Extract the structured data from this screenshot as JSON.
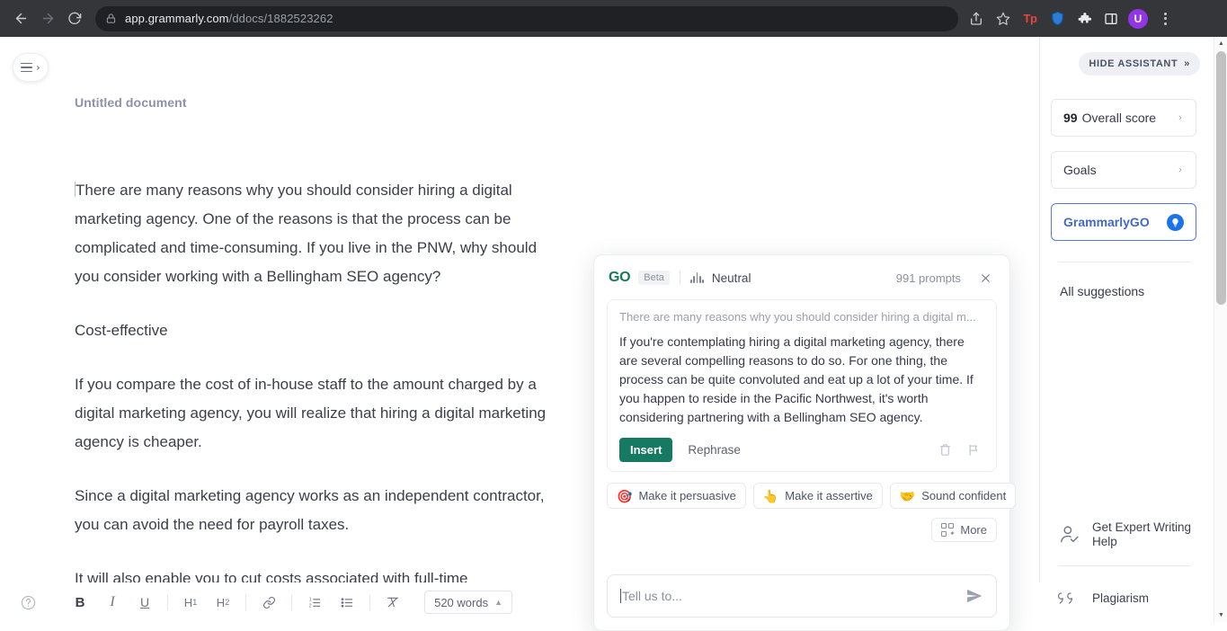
{
  "browser": {
    "back_label": "Back",
    "forward_label": "Forward",
    "reload_label": "Reload",
    "lock_icon": "lock-icon",
    "url_domain": "app.grammarly.com",
    "url_path": "/ddocs/1882523262",
    "actions": [
      {
        "name": "share-icon",
        "label": "Share"
      },
      {
        "name": "bookmark-star-icon",
        "label": "Bookmark this tab"
      },
      {
        "name": "extension-tp-icon",
        "label": "Tp"
      },
      {
        "name": "extension-shield-icon",
        "label": "Shield"
      },
      {
        "name": "extensions-puzzle-icon",
        "label": "Extensions"
      },
      {
        "name": "side-panel-icon",
        "label": "Side panel"
      },
      {
        "name": "profile-avatar",
        "label": "U"
      },
      {
        "name": "chrome-menu-icon",
        "label": "Customize and control"
      }
    ]
  },
  "editor": {
    "menu_button_label": "Open menu",
    "doc_title": "Untitled document",
    "paragraphs": [
      "There are many reasons why you should consider hiring a digital marketing agency. One of the reasons is that the process can be complicated and time-consuming. If you live in the PNW, why should you consider working with a Bellingham SEO agency?",
      "Cost-effective",
      "If you compare the cost of in-house staff to the amount charged by a digital marketing agency, you will realize that hiring a digital marketing agency is cheaper.",
      "Since a digital marketing agency works as an independent contractor, you can avoid the need for payroll taxes.",
      "It will also enable you to cut costs associated with full-time"
    ]
  },
  "toolbar": {
    "help_label": "?",
    "buttons": [
      {
        "name": "bold-button",
        "label": "B"
      },
      {
        "name": "italic-button",
        "label": "I"
      },
      {
        "name": "underline-button",
        "label": "U"
      },
      {
        "name": "heading-1-button",
        "label": "H1"
      },
      {
        "name": "heading-2-button",
        "label": "H2"
      },
      {
        "name": "link-button",
        "label": "link-icon"
      },
      {
        "name": "numbered-list-button",
        "label": "numbered-list-icon"
      },
      {
        "name": "bullet-list-button",
        "label": "bullet-list-icon"
      },
      {
        "name": "clear-format-button",
        "label": "clear-format-icon"
      }
    ],
    "h1_label": "H",
    "h1_sub": "1",
    "h2_label": "H",
    "h2_sub": "2",
    "word_count": "520 words",
    "word_count_caret": "▲"
  },
  "go_panel": {
    "logo": "GO",
    "beta_badge": "Beta",
    "tone_icon": "waveform-icon",
    "tone_label": "Neutral",
    "prompts_count": "991 prompts",
    "close_label": "×",
    "source_text": "There are many reasons why you should consider hiring a digital m...",
    "suggestion_text": "If you're contemplating hiring a digital marketing agency, there are several compelling reasons to do so. For one thing, the process can be quite convoluted and eat up a lot of your time. If you happen to reside in the Pacific Northwest, it's worth considering partnering with a Bellingham SEO agency.",
    "insert_label": "Insert",
    "rephrase_label": "Rephrase",
    "delete_icon": "trash-icon",
    "flag_icon": "flag-icon",
    "chips": [
      {
        "emoji": "🎯",
        "icon_name": "dart-icon",
        "label": "Make it persuasive"
      },
      {
        "emoji": "👆",
        "icon_name": "pointing-up-icon",
        "label": "Make it assertive"
      },
      {
        "emoji": "🤝",
        "icon_name": "handshake-icon",
        "label": "Sound confident"
      }
    ],
    "more_label": "More",
    "input_placeholder": "Tell us to...",
    "send_icon": "send-icon",
    "insert_color": "#167a63",
    "logo_color": "#157a5e"
  },
  "sidebar": {
    "hide_assistant_label": "HIDE ASSISTANT",
    "hide_assistant_chevron": "»",
    "overall_score_value": "99",
    "overall_score_label": "Overall score",
    "goals_label": "Goals",
    "grammarly_go_label": "GrammarlyGO",
    "all_suggestions_label": "All suggestions",
    "expert_help_label": "Get Expert Writing Help",
    "plagiarism_label": "Plagiarism",
    "chevron": "›",
    "accent_blue": "#4567c8",
    "bulb_blue": "#1a73e8"
  }
}
